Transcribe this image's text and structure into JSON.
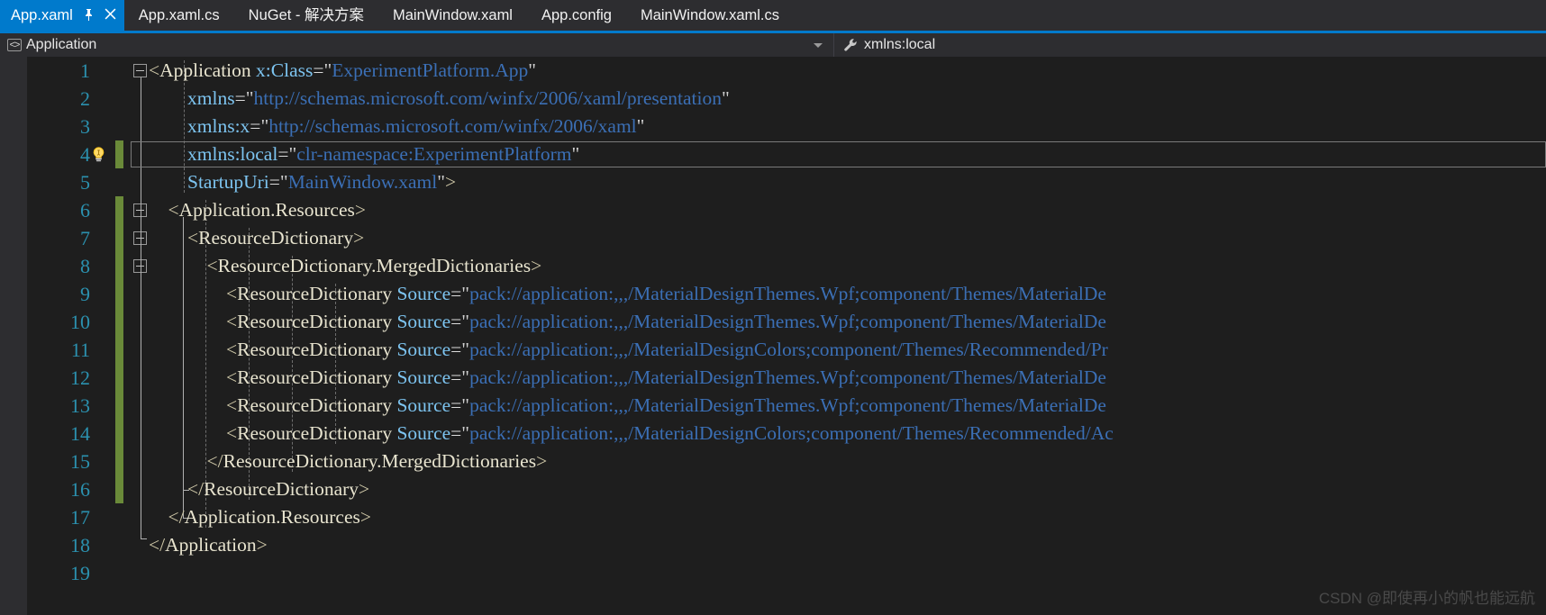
{
  "tabs": [
    {
      "label": "App.xaml",
      "active": true,
      "pin_icon": "pin-icon",
      "close_icon": "close-icon"
    },
    {
      "label": "App.xaml.cs",
      "active": false
    },
    {
      "label": "NuGet - 解决方案",
      "active": false
    },
    {
      "label": "MainWindow.xaml",
      "active": false
    },
    {
      "label": "App.config",
      "active": false
    },
    {
      "label": "MainWindow.xaml.cs",
      "active": false
    }
  ],
  "navbar": {
    "left": {
      "icon": "code-element-icon",
      "label": "Application",
      "caret": "chevron-down-icon"
    },
    "right": {
      "icon": "wrench-icon",
      "label": "xmlns:local"
    }
  },
  "editor": {
    "current_line": 4,
    "lightbulb_line": 4,
    "lines": [
      {
        "n": 1,
        "indent": 0,
        "segments": [
          {
            "t": "brack",
            "s": "<"
          },
          {
            "t": "tag",
            "s": "Application"
          },
          {
            "t": "plain",
            "s": " "
          },
          {
            "t": "attr",
            "s": "x:Class"
          },
          {
            "t": "eq",
            "s": "="
          },
          {
            "t": "quote",
            "s": "\""
          },
          {
            "t": "val",
            "s": "ExperimentPlatform.App"
          },
          {
            "t": "quote",
            "s": "\""
          }
        ]
      },
      {
        "n": 2,
        "indent": 0,
        "segments": [
          {
            "t": "plain",
            "s": "        "
          },
          {
            "t": "attr",
            "s": "xmlns"
          },
          {
            "t": "eq",
            "s": "="
          },
          {
            "t": "quote",
            "s": "\""
          },
          {
            "t": "val",
            "s": "http://schemas.microsoft.com/winfx/2006/xaml/presentation"
          },
          {
            "t": "quote",
            "s": "\""
          }
        ]
      },
      {
        "n": 3,
        "indent": 0,
        "segments": [
          {
            "t": "plain",
            "s": "        "
          },
          {
            "t": "attr",
            "s": "xmlns:x"
          },
          {
            "t": "eq",
            "s": "="
          },
          {
            "t": "quote",
            "s": "\""
          },
          {
            "t": "val",
            "s": "http://schemas.microsoft.com/winfx/2006/xaml"
          },
          {
            "t": "quote",
            "s": "\""
          }
        ]
      },
      {
        "n": 4,
        "indent": 0,
        "segments": [
          {
            "t": "plain",
            "s": "        "
          },
          {
            "t": "attr",
            "s": "xmlns:local"
          },
          {
            "t": "eq",
            "s": "="
          },
          {
            "t": "quote",
            "s": "\""
          },
          {
            "t": "val",
            "s": "clr-namespace:ExperimentPlatform"
          },
          {
            "t": "quote",
            "s": "\""
          }
        ]
      },
      {
        "n": 5,
        "indent": 0,
        "segments": [
          {
            "t": "plain",
            "s": "        "
          },
          {
            "t": "attr",
            "s": "StartupUri"
          },
          {
            "t": "eq",
            "s": "="
          },
          {
            "t": "quote",
            "s": "\""
          },
          {
            "t": "val",
            "s": "MainWindow.xaml"
          },
          {
            "t": "quote",
            "s": "\""
          },
          {
            "t": "brack",
            "s": ">"
          }
        ]
      },
      {
        "n": 6,
        "indent": 0,
        "segments": [
          {
            "t": "plain",
            "s": "    "
          },
          {
            "t": "brack",
            "s": "<"
          },
          {
            "t": "tag",
            "s": "Application.Resources"
          },
          {
            "t": "brack",
            "s": ">"
          }
        ]
      },
      {
        "n": 7,
        "indent": 0,
        "segments": [
          {
            "t": "plain",
            "s": "        "
          },
          {
            "t": "brack",
            "s": "<"
          },
          {
            "t": "tag",
            "s": "ResourceDictionary"
          },
          {
            "t": "brack",
            "s": ">"
          }
        ]
      },
      {
        "n": 8,
        "indent": 0,
        "segments": [
          {
            "t": "plain",
            "s": "            "
          },
          {
            "t": "brack",
            "s": "<"
          },
          {
            "t": "tag",
            "s": "ResourceDictionary.MergedDictionaries"
          },
          {
            "t": "brack",
            "s": ">"
          }
        ]
      },
      {
        "n": 9,
        "indent": 0,
        "segments": [
          {
            "t": "plain",
            "s": "                "
          },
          {
            "t": "brack",
            "s": "<"
          },
          {
            "t": "tag",
            "s": "ResourceDictionary"
          },
          {
            "t": "plain",
            "s": " "
          },
          {
            "t": "attr",
            "s": "Source"
          },
          {
            "t": "eq",
            "s": "="
          },
          {
            "t": "quote",
            "s": "\""
          },
          {
            "t": "val",
            "s": "pack://application:,,,/MaterialDesignThemes.Wpf;component/Themes/MaterialDe"
          }
        ]
      },
      {
        "n": 10,
        "indent": 0,
        "segments": [
          {
            "t": "plain",
            "s": "                "
          },
          {
            "t": "brack",
            "s": "<"
          },
          {
            "t": "tag",
            "s": "ResourceDictionary"
          },
          {
            "t": "plain",
            "s": " "
          },
          {
            "t": "attr",
            "s": "Source"
          },
          {
            "t": "eq",
            "s": "="
          },
          {
            "t": "quote",
            "s": "\""
          },
          {
            "t": "val",
            "s": "pack://application:,,,/MaterialDesignThemes.Wpf;component/Themes/MaterialDe"
          }
        ]
      },
      {
        "n": 11,
        "indent": 0,
        "segments": [
          {
            "t": "plain",
            "s": "                "
          },
          {
            "t": "brack",
            "s": "<"
          },
          {
            "t": "tag",
            "s": "ResourceDictionary"
          },
          {
            "t": "plain",
            "s": " "
          },
          {
            "t": "attr",
            "s": "Source"
          },
          {
            "t": "eq",
            "s": "="
          },
          {
            "t": "quote",
            "s": "\""
          },
          {
            "t": "val",
            "s": "pack://application:,,,/MaterialDesignColors;component/Themes/Recommended/Pr"
          }
        ]
      },
      {
        "n": 12,
        "indent": 0,
        "segments": [
          {
            "t": "plain",
            "s": "                "
          },
          {
            "t": "brack",
            "s": "<"
          },
          {
            "t": "tag",
            "s": "ResourceDictionary"
          },
          {
            "t": "plain",
            "s": " "
          },
          {
            "t": "attr",
            "s": "Source"
          },
          {
            "t": "eq",
            "s": "="
          },
          {
            "t": "quote",
            "s": "\""
          },
          {
            "t": "val",
            "s": "pack://application:,,,/MaterialDesignThemes.Wpf;component/Themes/MaterialDe"
          }
        ]
      },
      {
        "n": 13,
        "indent": 0,
        "segments": [
          {
            "t": "plain",
            "s": "                "
          },
          {
            "t": "brack",
            "s": "<"
          },
          {
            "t": "tag",
            "s": "ResourceDictionary"
          },
          {
            "t": "plain",
            "s": " "
          },
          {
            "t": "attr",
            "s": "Source"
          },
          {
            "t": "eq",
            "s": "="
          },
          {
            "t": "quote",
            "s": "\""
          },
          {
            "t": "val",
            "s": "pack://application:,,,/MaterialDesignThemes.Wpf;component/Themes/MaterialDe"
          }
        ]
      },
      {
        "n": 14,
        "indent": 0,
        "segments": [
          {
            "t": "plain",
            "s": "                "
          },
          {
            "t": "brack",
            "s": "<"
          },
          {
            "t": "tag",
            "s": "ResourceDictionary"
          },
          {
            "t": "plain",
            "s": " "
          },
          {
            "t": "attr",
            "s": "Source"
          },
          {
            "t": "eq",
            "s": "="
          },
          {
            "t": "quote",
            "s": "\""
          },
          {
            "t": "val",
            "s": "pack://application:,,,/MaterialDesignColors;component/Themes/Recommended/Ac"
          }
        ]
      },
      {
        "n": 15,
        "indent": 0,
        "segments": [
          {
            "t": "plain",
            "s": "            "
          },
          {
            "t": "brack",
            "s": "</"
          },
          {
            "t": "tag",
            "s": "ResourceDictionary.MergedDictionaries"
          },
          {
            "t": "brack",
            "s": ">"
          }
        ]
      },
      {
        "n": 16,
        "indent": 0,
        "segments": [
          {
            "t": "plain",
            "s": "        "
          },
          {
            "t": "brack",
            "s": "</"
          },
          {
            "t": "tag",
            "s": "ResourceDictionary"
          },
          {
            "t": "brack",
            "s": ">"
          }
        ]
      },
      {
        "n": 17,
        "indent": 0,
        "segments": [
          {
            "t": "plain",
            "s": "    "
          },
          {
            "t": "brack",
            "s": "</"
          },
          {
            "t": "tag",
            "s": "Application.Resources"
          },
          {
            "t": "brack",
            "s": ">"
          }
        ]
      },
      {
        "n": 18,
        "indent": 0,
        "segments": [
          {
            "t": "brack",
            "s": "</"
          },
          {
            "t": "tag",
            "s": "Application"
          },
          {
            "t": "brack",
            "s": ">"
          }
        ]
      },
      {
        "n": 19,
        "indent": 0,
        "segments": []
      }
    ],
    "change_bar_lines": [
      4,
      6,
      7,
      8,
      9,
      10,
      11,
      12,
      13,
      14,
      15,
      16
    ],
    "collapse_lines": [
      1,
      6,
      7,
      8
    ]
  },
  "watermark": "CSDN @即使再小的帆也能远航",
  "colors": {
    "accent": "#007acc",
    "editor_bg": "#1e1e1e",
    "chrome_bg": "#2d2d30",
    "lineno": "#2b91af",
    "tag": "#e8e4cf",
    "attr": "#7dc4f0",
    "value": "#3b6fb5",
    "changebar": "#6a8a39"
  }
}
